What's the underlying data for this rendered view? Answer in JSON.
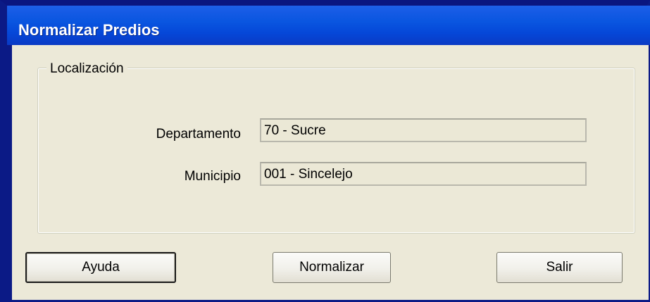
{
  "window": {
    "title": "Normalizar Predios"
  },
  "location_group": {
    "legend": "Localización",
    "fields": [
      {
        "label": "Departamento",
        "value": "70 - Sucre"
      },
      {
        "label": "Municipio",
        "value": "001 - Sincelejo"
      }
    ]
  },
  "buttons": {
    "help": "Ayuda",
    "normalize": "Normalizar",
    "exit": "Salir"
  },
  "colors": {
    "titlebar": "#0a56e0",
    "window_bg": "#ece9d8"
  }
}
